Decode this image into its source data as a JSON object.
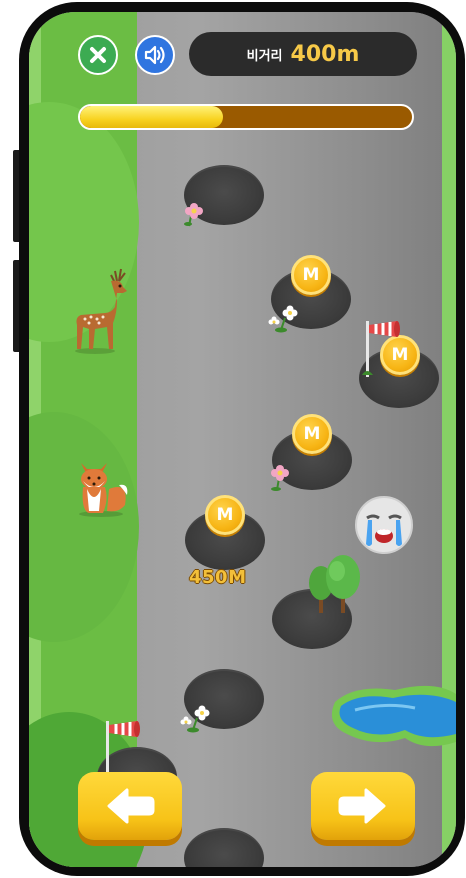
{
  "hud": {
    "close_icon": "close-x-icon",
    "sound_icon": "speaker-icon",
    "distance_label": "비거리",
    "distance_value": "400m",
    "progress_fraction": 0.43,
    "colors": {
      "close_button": "#3cab52",
      "sound_button": "#2f75e0",
      "progress_fill": "#f8d321",
      "progress_track": "#9a5a00"
    }
  },
  "board": {
    "coin_label": "M",
    "distance_marker": "450M",
    "emoji": "crying-face",
    "animals": [
      "deer",
      "fox"
    ]
  },
  "controls": {
    "left_icon": "arrow-left-icon",
    "right_icon": "arrow-right-icon",
    "color": "#f7c318"
  }
}
